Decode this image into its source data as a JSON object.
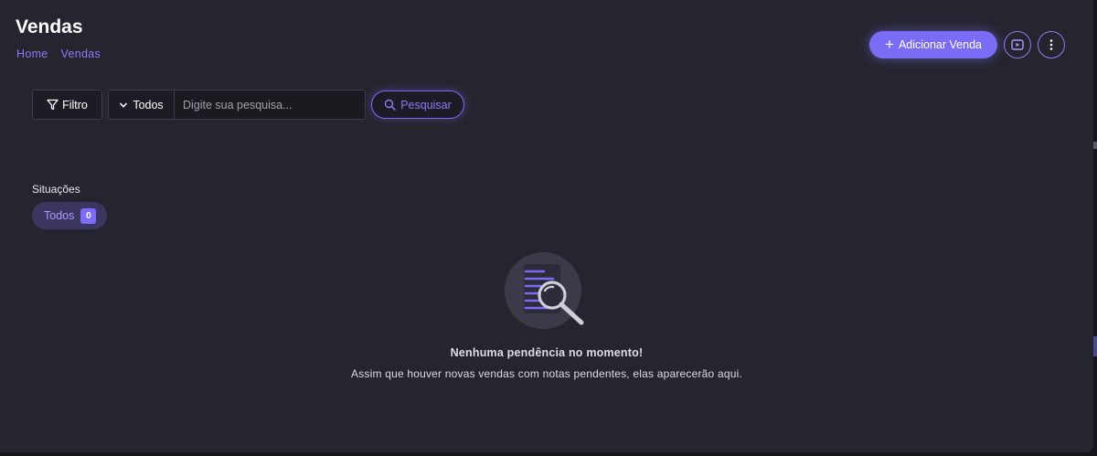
{
  "header": {
    "title": "Vendas",
    "breadcrumb": [
      "Home",
      "Vendas"
    ],
    "add_button_label": "Adicionar Venda",
    "add_button_icon": "plus-icon",
    "video_button_icon": "play-video-icon",
    "more_button_icon": "more-vertical-icon"
  },
  "toolbar": {
    "filter_label": "Filtro",
    "filter_icon": "filter-icon",
    "select_value": "Todos",
    "search_placeholder": "Digite sua pesquisa...",
    "search_button_label": "Pesquisar",
    "search_icon": "search-icon"
  },
  "situacoes": {
    "label": "Situações",
    "chips": [
      {
        "label": "Todos",
        "count": "0"
      }
    ]
  },
  "empty_state": {
    "icon": "document-search-icon",
    "title": "Nenhuma pendência no momento!",
    "message": "Assim que houver novas vendas com notas pendentes, elas aparecerão aqui."
  },
  "colors": {
    "accent": "#7b6cf6",
    "background": "#25252f",
    "chip_background": "#3a3660"
  }
}
